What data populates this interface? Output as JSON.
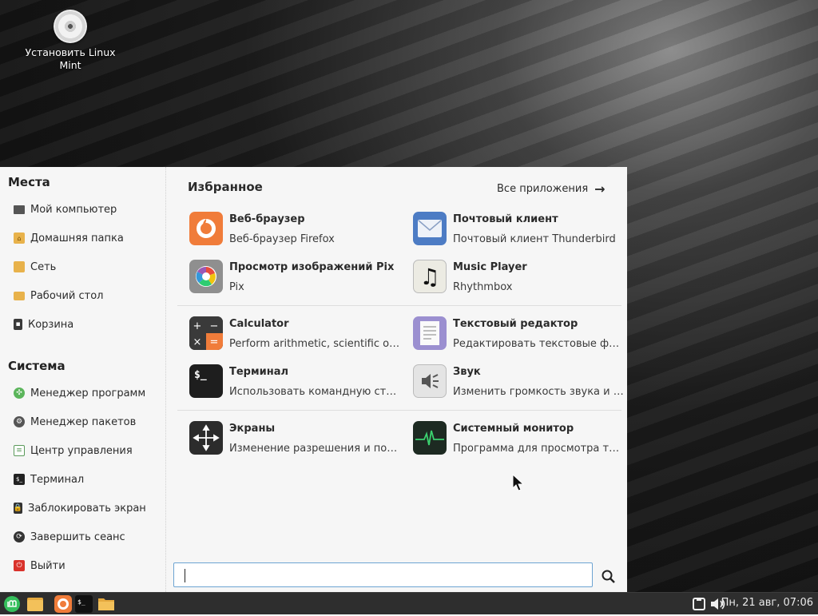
{
  "desktop": {
    "icons": [
      {
        "label": "Установить Linux Mint"
      }
    ]
  },
  "menu": {
    "places": {
      "title": "Места",
      "items": [
        {
          "label": "Мой компьютер",
          "icon": "computer-icon"
        },
        {
          "label": "Домашняя папка",
          "icon": "home-folder-icon"
        },
        {
          "label": "Сеть",
          "icon": "network-folder-icon"
        },
        {
          "label": "Рабочий стол",
          "icon": "desktop-folder-icon"
        },
        {
          "label": "Корзина",
          "icon": "trash-icon"
        }
      ]
    },
    "system": {
      "title": "Система",
      "items": [
        {
          "label": "Менеджер программ",
          "icon": "software-manager-icon"
        },
        {
          "label": "Менеджер пакетов",
          "icon": "package-manager-icon"
        },
        {
          "label": "Центр управления",
          "icon": "control-center-icon"
        },
        {
          "label": "Терминал",
          "icon": "terminal-icon"
        },
        {
          "label": "Заблокировать экран",
          "icon": "lock-icon"
        },
        {
          "label": "Завершить сеанс",
          "icon": "logout-icon"
        },
        {
          "label": "Выйти",
          "icon": "power-icon"
        }
      ]
    },
    "favorites": {
      "title": "Избранное",
      "all_apps_label": "Все приложения",
      "apps": [
        {
          "name": "Веб-браузер",
          "desc": "Веб-браузер Firefox",
          "icon": "firefox-icon"
        },
        {
          "name": "Почтовый клиент",
          "desc": "Почтовый клиент Thunderbird",
          "icon": "mail-icon"
        },
        {
          "name": "Просмотр изображений Pix",
          "desc": "Pix",
          "icon": "pix-icon"
        },
        {
          "name": "Music Player",
          "desc": "Rhythmbox",
          "icon": "music-icon"
        },
        {
          "name": "Calculator",
          "desc": "Perform arithmetic, scientific or …",
          "icon": "calculator-icon"
        },
        {
          "name": "Текстовый редактор",
          "desc": "Редактировать текстовые фай…",
          "icon": "text-editor-icon"
        },
        {
          "name": "Терминал",
          "desc": "Использовать командную стр…",
          "icon": "terminal-icon"
        },
        {
          "name": "Звук",
          "desc": "Изменить громкость звука и с…",
          "icon": "sound-icon"
        },
        {
          "name": "Экраны",
          "desc": "Изменение разрешения и поз…",
          "icon": "displays-icon"
        },
        {
          "name": "Системный монитор",
          "desc": "Программа для просмотра те…",
          "icon": "system-monitor-icon"
        }
      ]
    },
    "search": {
      "value": "",
      "placeholder": ""
    }
  },
  "taskbar": {
    "clock": "Пн, 21 авг, 07:06",
    "launchers": [
      "mint-menu-icon",
      "files-icon",
      "firefox-icon",
      "terminal-icon",
      "folder-icon"
    ],
    "tray": [
      "network-icon",
      "volume-icon"
    ]
  },
  "colors": {
    "menu_bg": "#f6f6f6",
    "taskbar_bg": "#2e2e2e",
    "accent": "#6da4d2",
    "mint_green": "#35bf5c"
  }
}
